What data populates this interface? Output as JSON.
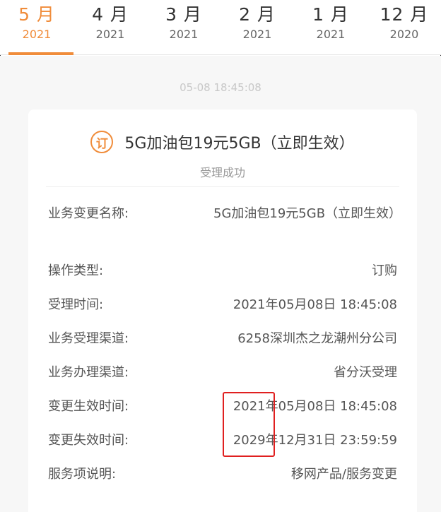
{
  "tabs": [
    {
      "month": "5 月",
      "year": "2021",
      "active": true
    },
    {
      "month": "4 月",
      "year": "2021",
      "active": false
    },
    {
      "month": "3 月",
      "year": "2021",
      "active": false
    },
    {
      "month": "2 月",
      "year": "2021",
      "active": false
    },
    {
      "month": "1 月",
      "year": "2021",
      "active": false
    },
    {
      "month": "12 月",
      "year": "2020",
      "active": false
    }
  ],
  "timestamp": "05-08 18:45:08",
  "card": {
    "icon_glyph": "订",
    "icon": "order-icon",
    "title": "5G加油包19元5GB（立即生效）",
    "status": "受理成功",
    "rows": [
      {
        "label": "业务变更名称:",
        "value": "5G加油包19元5GB（立即生效）"
      },
      {
        "label": "操作类型:",
        "value": "订购"
      },
      {
        "label": "受理时间:",
        "value": "2021年05月08日 18:45:08"
      },
      {
        "label": "业务受理渠道:",
        "value": "6258深圳杰之龙潮州分公司"
      },
      {
        "label": "业务办理渠道:",
        "value": "省分沃受理"
      },
      {
        "label": "变更生效时间:",
        "value": "2021年05月08日 18:45:08"
      },
      {
        "label": "变更失效时间:",
        "value": "2029年12月31日 23:59:59"
      },
      {
        "label": "服务项说明:",
        "value": "移网产品/服务变更"
      }
    ]
  },
  "colors": {
    "accent": "#f08c3a",
    "highlight": "#e02020"
  }
}
